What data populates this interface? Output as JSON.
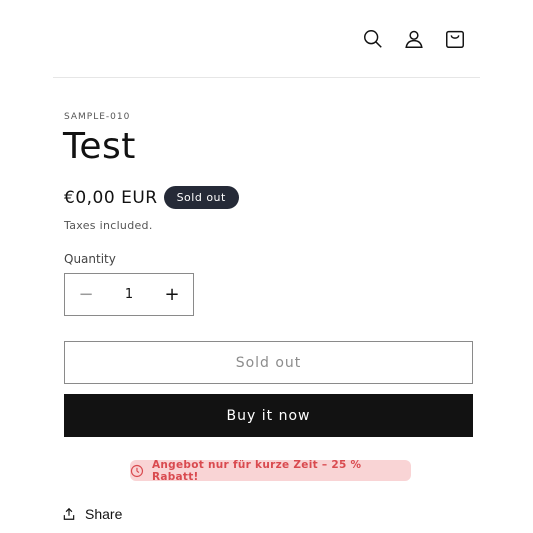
{
  "header": {
    "icons": [
      "search-icon",
      "account-icon",
      "cart-icon"
    ]
  },
  "product": {
    "sku": "SAMPLE-010",
    "title": "Test",
    "price": "€0,00 EUR",
    "badge": "Sold out",
    "taxes_note": "Taxes included."
  },
  "quantity": {
    "label": "Quantity",
    "value": "1",
    "minus": "−",
    "plus": "+"
  },
  "buttons": {
    "sold_out_label": "Sold out",
    "buy_now_label": "Buy it now"
  },
  "promo": {
    "icon": "clock-icon",
    "text": "Angebot nur für kurze Zeit – 25 % Rabatt!",
    "background": "#f9d4d5",
    "color": "#d94a4f"
  },
  "share": {
    "icon": "share-icon",
    "label": "Share"
  }
}
